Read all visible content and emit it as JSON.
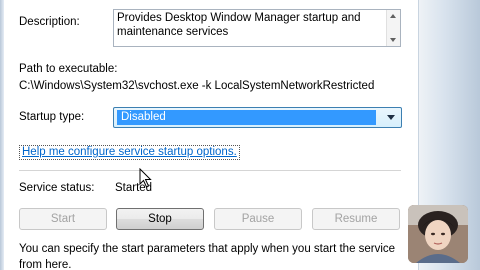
{
  "description": {
    "label": "Description:",
    "text": "Provides Desktop Window Manager startup and maintenance services"
  },
  "path": {
    "label": "Path to executable:",
    "value": "C:\\Windows\\System32\\svchost.exe -k LocalSystemNetworkRestricted"
  },
  "startup": {
    "label": "Startup type:",
    "selected": "Disabled"
  },
  "help_link": "Help me configure service startup options.",
  "service_status": {
    "label": "Service status:",
    "value": "Started"
  },
  "buttons": {
    "start": "Start",
    "stop": "Stop",
    "pause": "Pause",
    "resume": "Resume"
  },
  "footer_text": "You can specify the start parameters that apply when you start the service from here.",
  "icons": {
    "cursor": "arrow-cursor-icon",
    "dropdown": "chevron-down-icon",
    "scroll_up": "scroll-up-arrow-icon",
    "scroll_down": "scroll-down-arrow-icon"
  },
  "colors": {
    "selection": "#3399ff",
    "link": "#0066cc",
    "dropdown_border": "#3c7fb1"
  }
}
